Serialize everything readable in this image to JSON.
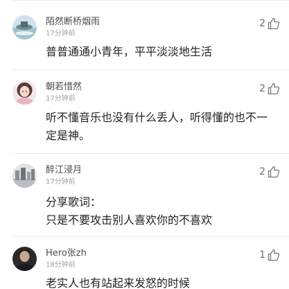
{
  "comments": [
    {
      "username": "陌然断桥烟雨",
      "time": "17分钟前",
      "likes": "2",
      "content": "普普通通小青年，平平淡淡地生活",
      "avatar_icon": "landscape-avatar-icon"
    },
    {
      "username": "朝若惜然",
      "time": "17分钟前",
      "likes": "2",
      "content": "听不懂音乐也没有什么丢人，听得懂的也不一定是神。",
      "avatar_icon": "girl-avatar-icon"
    },
    {
      "username": "醉江浸月",
      "time": "17分钟前",
      "likes": "2",
      "content": "分享歌词：\n只是不要攻击别人喜欢你的不喜欢",
      "avatar_icon": "city-avatar-icon"
    },
    {
      "username": "Hero张zh",
      "time": "18分钟前",
      "likes": "1",
      "content": "老实人也有站起来发怒的时候",
      "avatar_icon": "man-avatar-icon"
    }
  ],
  "colors": {
    "username": "#4a4a4a",
    "timestamp": "#a0a0a0",
    "content": "#222222",
    "divider": "#ececec"
  }
}
